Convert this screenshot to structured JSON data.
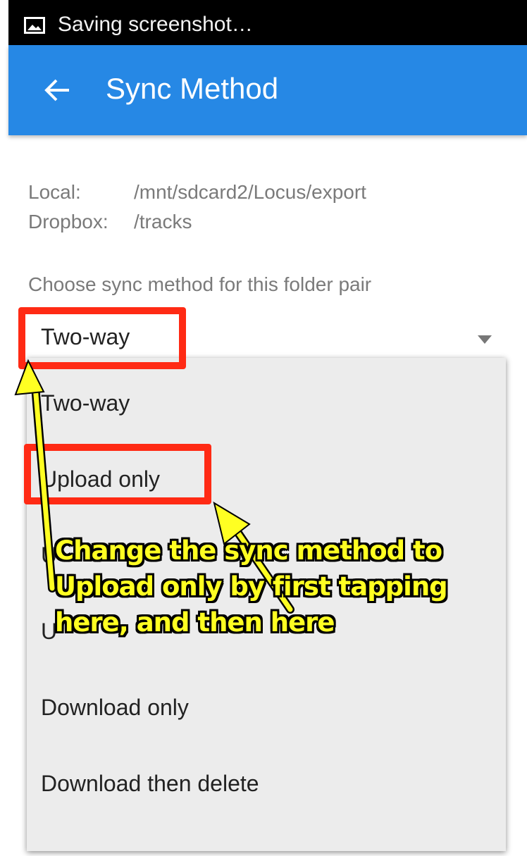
{
  "status_bar": {
    "icon": "image-icon",
    "text": "Saving screenshot…"
  },
  "app_bar": {
    "back_icon": "arrow-left-icon",
    "title": "Sync Method",
    "color": "#2688e5"
  },
  "folders": {
    "local_label": "Local:",
    "local_path": "/mnt/sdcard2/Locus/export",
    "dropbox_label": "Dropbox:",
    "dropbox_path": "/tracks"
  },
  "sync_method": {
    "label": "Choose sync method for this folder pair",
    "selected": "Two-way",
    "arrow_icon": "dropdown-triangle-icon",
    "options": [
      "Two-way",
      "Upload only",
      "U",
      "U",
      "Download only",
      "Download then delete"
    ]
  },
  "annotation": {
    "lines": [
      "Change the sync method to",
      "Upload only by first tapping",
      "here, and then here"
    ],
    "text_color": "#ffff22",
    "highlight_color": "#ff2a14"
  }
}
